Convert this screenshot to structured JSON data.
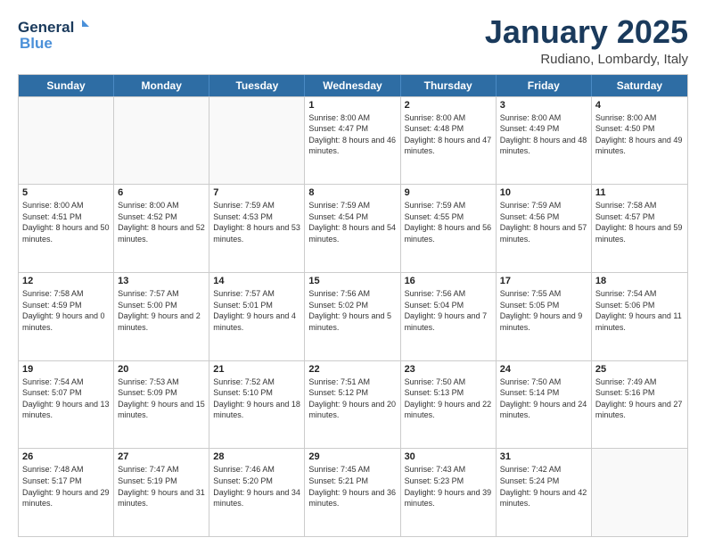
{
  "logo": {
    "line1": "General",
    "line2": "Blue"
  },
  "title": "January 2025",
  "subtitle": "Rudiano, Lombardy, Italy",
  "days": [
    "Sunday",
    "Monday",
    "Tuesday",
    "Wednesday",
    "Thursday",
    "Friday",
    "Saturday"
  ],
  "weeks": [
    [
      {
        "day": "",
        "info": ""
      },
      {
        "day": "",
        "info": ""
      },
      {
        "day": "",
        "info": ""
      },
      {
        "day": "1",
        "info": "Sunrise: 8:00 AM\nSunset: 4:47 PM\nDaylight: 8 hours and 46 minutes."
      },
      {
        "day": "2",
        "info": "Sunrise: 8:00 AM\nSunset: 4:48 PM\nDaylight: 8 hours and 47 minutes."
      },
      {
        "day": "3",
        "info": "Sunrise: 8:00 AM\nSunset: 4:49 PM\nDaylight: 8 hours and 48 minutes."
      },
      {
        "day": "4",
        "info": "Sunrise: 8:00 AM\nSunset: 4:50 PM\nDaylight: 8 hours and 49 minutes."
      }
    ],
    [
      {
        "day": "5",
        "info": "Sunrise: 8:00 AM\nSunset: 4:51 PM\nDaylight: 8 hours and 50 minutes."
      },
      {
        "day": "6",
        "info": "Sunrise: 8:00 AM\nSunset: 4:52 PM\nDaylight: 8 hours and 52 minutes."
      },
      {
        "day": "7",
        "info": "Sunrise: 7:59 AM\nSunset: 4:53 PM\nDaylight: 8 hours and 53 minutes."
      },
      {
        "day": "8",
        "info": "Sunrise: 7:59 AM\nSunset: 4:54 PM\nDaylight: 8 hours and 54 minutes."
      },
      {
        "day": "9",
        "info": "Sunrise: 7:59 AM\nSunset: 4:55 PM\nDaylight: 8 hours and 56 minutes."
      },
      {
        "day": "10",
        "info": "Sunrise: 7:59 AM\nSunset: 4:56 PM\nDaylight: 8 hours and 57 minutes."
      },
      {
        "day": "11",
        "info": "Sunrise: 7:58 AM\nSunset: 4:57 PM\nDaylight: 8 hours and 59 minutes."
      }
    ],
    [
      {
        "day": "12",
        "info": "Sunrise: 7:58 AM\nSunset: 4:59 PM\nDaylight: 9 hours and 0 minutes."
      },
      {
        "day": "13",
        "info": "Sunrise: 7:57 AM\nSunset: 5:00 PM\nDaylight: 9 hours and 2 minutes."
      },
      {
        "day": "14",
        "info": "Sunrise: 7:57 AM\nSunset: 5:01 PM\nDaylight: 9 hours and 4 minutes."
      },
      {
        "day": "15",
        "info": "Sunrise: 7:56 AM\nSunset: 5:02 PM\nDaylight: 9 hours and 5 minutes."
      },
      {
        "day": "16",
        "info": "Sunrise: 7:56 AM\nSunset: 5:04 PM\nDaylight: 9 hours and 7 minutes."
      },
      {
        "day": "17",
        "info": "Sunrise: 7:55 AM\nSunset: 5:05 PM\nDaylight: 9 hours and 9 minutes."
      },
      {
        "day": "18",
        "info": "Sunrise: 7:54 AM\nSunset: 5:06 PM\nDaylight: 9 hours and 11 minutes."
      }
    ],
    [
      {
        "day": "19",
        "info": "Sunrise: 7:54 AM\nSunset: 5:07 PM\nDaylight: 9 hours and 13 minutes."
      },
      {
        "day": "20",
        "info": "Sunrise: 7:53 AM\nSunset: 5:09 PM\nDaylight: 9 hours and 15 minutes."
      },
      {
        "day": "21",
        "info": "Sunrise: 7:52 AM\nSunset: 5:10 PM\nDaylight: 9 hours and 18 minutes."
      },
      {
        "day": "22",
        "info": "Sunrise: 7:51 AM\nSunset: 5:12 PM\nDaylight: 9 hours and 20 minutes."
      },
      {
        "day": "23",
        "info": "Sunrise: 7:50 AM\nSunset: 5:13 PM\nDaylight: 9 hours and 22 minutes."
      },
      {
        "day": "24",
        "info": "Sunrise: 7:50 AM\nSunset: 5:14 PM\nDaylight: 9 hours and 24 minutes."
      },
      {
        "day": "25",
        "info": "Sunrise: 7:49 AM\nSunset: 5:16 PM\nDaylight: 9 hours and 27 minutes."
      }
    ],
    [
      {
        "day": "26",
        "info": "Sunrise: 7:48 AM\nSunset: 5:17 PM\nDaylight: 9 hours and 29 minutes."
      },
      {
        "day": "27",
        "info": "Sunrise: 7:47 AM\nSunset: 5:19 PM\nDaylight: 9 hours and 31 minutes."
      },
      {
        "day": "28",
        "info": "Sunrise: 7:46 AM\nSunset: 5:20 PM\nDaylight: 9 hours and 34 minutes."
      },
      {
        "day": "29",
        "info": "Sunrise: 7:45 AM\nSunset: 5:21 PM\nDaylight: 9 hours and 36 minutes."
      },
      {
        "day": "30",
        "info": "Sunrise: 7:43 AM\nSunset: 5:23 PM\nDaylight: 9 hours and 39 minutes."
      },
      {
        "day": "31",
        "info": "Sunrise: 7:42 AM\nSunset: 5:24 PM\nDaylight: 9 hours and 42 minutes."
      },
      {
        "day": "",
        "info": ""
      }
    ]
  ]
}
